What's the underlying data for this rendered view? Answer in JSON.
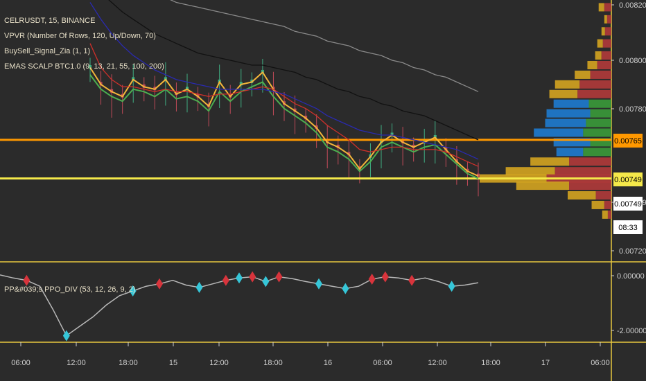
{
  "chart_data": [
    {
      "type": "line",
      "indicator_labels": [
        "CELRUSDT, 15, BINANCE",
        "VPVR (Number Of Rows, 120, Up/Down, 70)",
        "BuySell_Signal_Zia (1, 1)",
        "EMAS SCALP BTC1.0 (9, 13, 21, 55, 100, 200)"
      ],
      "y_ticks": [
        "0.00820",
        "0.00800",
        "0.00780",
        "0.00749",
        "0.00720"
      ],
      "ylim": [
        0.00715,
        0.00823
      ],
      "horizontal_lines": [
        {
          "value": 0.00765,
          "color": "#ff9800"
        },
        {
          "value": 0.00749,
          "color": "#f5e94a"
        }
      ],
      "price_tags": [
        {
          "text": "0.00765",
          "bg": "#ff9800",
          "fg": "#000000"
        },
        {
          "text": "0.00749",
          "bg": "#f5e94a",
          "fg": "#000000"
        },
        {
          "text": "0.00749",
          "bg": "#ffffff",
          "fg": "#000000"
        },
        {
          "text": "08:33",
          "bg": "#ffffff",
          "fg": "#000000"
        }
      ],
      "series": [
        {
          "color": "#f4b63a",
          "values": [
            0.00795,
            0.00788,
            0.00785,
            0.00783,
            0.0079,
            0.00787,
            0.00786,
            0.0079,
            0.00784,
            0.00786,
            0.00783,
            0.00779,
            0.00789,
            0.00783,
            0.00788,
            0.00789,
            0.00793,
            0.00786,
            0.0078,
            0.00777,
            0.00774,
            0.0077,
            0.00764,
            0.00762,
            0.00759,
            0.00753,
            0.00758,
            0.00764,
            0.00767,
            0.00764,
            0.00762,
            0.00764,
            0.00766,
            0.00761,
            0.00756,
            0.00752,
            0.0075
          ]
        },
        {
          "color": "#4caf50",
          "values": [
            0.00792,
            0.00786,
            0.00783,
            0.00781,
            0.00786,
            0.00785,
            0.00783,
            0.00786,
            0.00782,
            0.00783,
            0.00781,
            0.00777,
            0.00785,
            0.00781,
            0.00785,
            0.00787,
            0.00789,
            0.00783,
            0.00778,
            0.00775,
            0.00772,
            0.00768,
            0.00762,
            0.0076,
            0.00757,
            0.00752,
            0.00756,
            0.00762,
            0.00764,
            0.00762,
            0.0076,
            0.00762,
            0.00763,
            0.00759,
            0.00755,
            0.00751,
            0.00749
          ]
        },
        {
          "color": "#d0302a",
          "values": [
            0.00805,
            0.00795,
            0.0079,
            0.00787,
            0.00787,
            0.00786,
            0.00785,
            0.00786,
            0.00785,
            0.00785,
            0.00784,
            0.00783,
            0.00784,
            0.00784,
            0.00785,
            0.00786,
            0.00787,
            0.00786,
            0.00783,
            0.0078,
            0.00778,
            0.00775,
            0.00771,
            0.00768,
            0.00765,
            0.00761,
            0.0076,
            0.00761,
            0.00762,
            0.00762,
            0.00761,
            0.00761,
            0.00761,
            0.0076,
            0.00758,
            0.00756,
            0.00754
          ]
        },
        {
          "color": "#2a2ab0",
          "values": [
            0.00822,
            0.00815,
            0.00809,
            0.00804,
            0.008,
            0.00797,
            0.00794,
            0.00792,
            0.0079,
            0.00789,
            0.00788,
            0.00787,
            0.00786,
            0.00786,
            0.00786,
            0.00786,
            0.00786,
            0.00785,
            0.00784,
            0.00782,
            0.0078,
            0.00778,
            0.00775,
            0.00773,
            0.00771,
            0.00769,
            0.00768,
            0.00767,
            0.00767,
            0.00766,
            0.00765,
            0.00764,
            0.00763,
            0.00762,
            0.00761,
            0.00759,
            0.00757
          ]
        },
        {
          "color": "#111111",
          "values": [
            0.0083,
            0.00826,
            0.00822,
            0.00818,
            0.00815,
            0.00812,
            0.00809,
            0.00807,
            0.00805,
            0.00803,
            0.00801,
            0.008,
            0.00799,
            0.00798,
            0.00797,
            0.00796,
            0.00796,
            0.00795,
            0.00794,
            0.00793,
            0.00791,
            0.0079,
            0.00788,
            0.00786,
            0.00785,
            0.00783,
            0.00782,
            0.0078,
            0.00779,
            0.00777,
            0.00776,
            0.00775,
            0.00773,
            0.00771,
            0.00769,
            0.00767,
            0.00765
          ]
        },
        {
          "color": "#8a8a8a",
          "values": [
            0.0083,
            0.00829,
            0.00829,
            0.00828,
            0.00827,
            0.00826,
            0.00825,
            0.00824,
            0.00822,
            0.00821,
            0.0082,
            0.00819,
            0.00818,
            0.00817,
            0.00816,
            0.00815,
            0.00814,
            0.00813,
            0.00812,
            0.0081,
            0.00809,
            0.00808,
            0.00806,
            0.00805,
            0.00804,
            0.00802,
            0.00801,
            0.008,
            0.00798,
            0.00797,
            0.00795,
            0.00794,
            0.00792,
            0.00791,
            0.00789,
            0.00787,
            0.00785
          ]
        }
      ],
      "volume_profile": {
        "note_colors": {
          "up": "#d4a420",
          "down": "#b03a3a",
          "value_area_up": "#1e7bd0",
          "value_area_down": "#3a9a3a"
        },
        "rows": [
          {
            "price": 0.0082,
            "up": 8,
            "down": 10
          },
          {
            "price": 0.00815,
            "up": 4,
            "down": 6
          },
          {
            "price": 0.0081,
            "up": 5,
            "down": 9
          },
          {
            "price": 0.00805,
            "up": 8,
            "down": 12
          },
          {
            "price": 0.008,
            "up": 9,
            "down": 14
          },
          {
            "price": 0.00796,
            "up": 14,
            "down": 20
          },
          {
            "price": 0.00792,
            "up": 22,
            "down": 30
          },
          {
            "price": 0.00788,
            "up": 35,
            "down": 45
          },
          {
            "price": 0.00784,
            "up": 40,
            "down": 48
          },
          {
            "price": 0.0078,
            "up": 50,
            "down": 32
          },
          {
            "price": 0.00776,
            "up": 62,
            "down": 30
          },
          {
            "price": 0.00772,
            "up": 58,
            "down": 36
          },
          {
            "price": 0.00768,
            "up": 70,
            "down": 40
          },
          {
            "price": 0.00764,
            "up": 52,
            "down": 30
          },
          {
            "price": 0.0076,
            "up": 38,
            "down": 40
          },
          {
            "price": 0.00756,
            "up": 55,
            "down": 60
          },
          {
            "price": 0.00752,
            "up": 70,
            "down": 80
          },
          {
            "price": 0.00749,
            "up": 95,
            "down": 92
          },
          {
            "price": 0.00746,
            "up": 75,
            "down": 60
          },
          {
            "price": 0.00742,
            "up": 40,
            "down": 22
          },
          {
            "price": 0.00738,
            "up": 18,
            "down": 10
          },
          {
            "price": 0.00734,
            "up": 8,
            "down": 5
          }
        ]
      }
    },
    {
      "type": "line",
      "title": "PP&#039;s PPO_DIV (53, 12, 26, 9, 2)",
      "y_ticks": [
        "0.00000",
        "-2.00000"
      ],
      "ylim": [
        -2.4,
        0.6
      ],
      "series": [
        {
          "color": "#b8b8b8",
          "values": [
            0.28,
            0.15,
            0.05,
            -0.2,
            -1.2,
            -2.3,
            -1.9,
            -1.5,
            -1.0,
            -0.6,
            -0.4,
            -0.2,
            -0.1,
            0.05,
            -0.15,
            -0.25,
            -0.1,
            0.05,
            0.15,
            0.2,
            0.0,
            0.2,
            0.12,
            0.0,
            -0.1,
            -0.2,
            -0.3,
            -0.2,
            0.1,
            0.2,
            0.15,
            0.05,
            0.15,
            0.0,
            -0.2,
            -0.15,
            -0.05
          ]
        }
      ],
      "signals": [
        {
          "i": 2,
          "kind": "bear"
        },
        {
          "i": 5,
          "kind": "bull"
        },
        {
          "i": 10,
          "kind": "bull"
        },
        {
          "i": 12,
          "kind": "bear"
        },
        {
          "i": 15,
          "kind": "bull"
        },
        {
          "i": 17,
          "kind": "bear"
        },
        {
          "i": 18,
          "kind": "bull"
        },
        {
          "i": 19,
          "kind": "bear"
        },
        {
          "i": 20,
          "kind": "bull"
        },
        {
          "i": 21,
          "kind": "bear"
        },
        {
          "i": 24,
          "kind": "bull"
        },
        {
          "i": 26,
          "kind": "bull"
        },
        {
          "i": 28,
          "kind": "bear"
        },
        {
          "i": 29,
          "kind": "bear"
        },
        {
          "i": 31,
          "kind": "bear"
        },
        {
          "i": 34,
          "kind": "bull"
        }
      ]
    }
  ],
  "x_ticks": [
    "06:00",
    "12:00",
    "18:00",
    "15",
    "12:00",
    "18:00",
    "16",
    "06:00",
    "12:00",
    "18:00",
    "17",
    "06:00"
  ]
}
